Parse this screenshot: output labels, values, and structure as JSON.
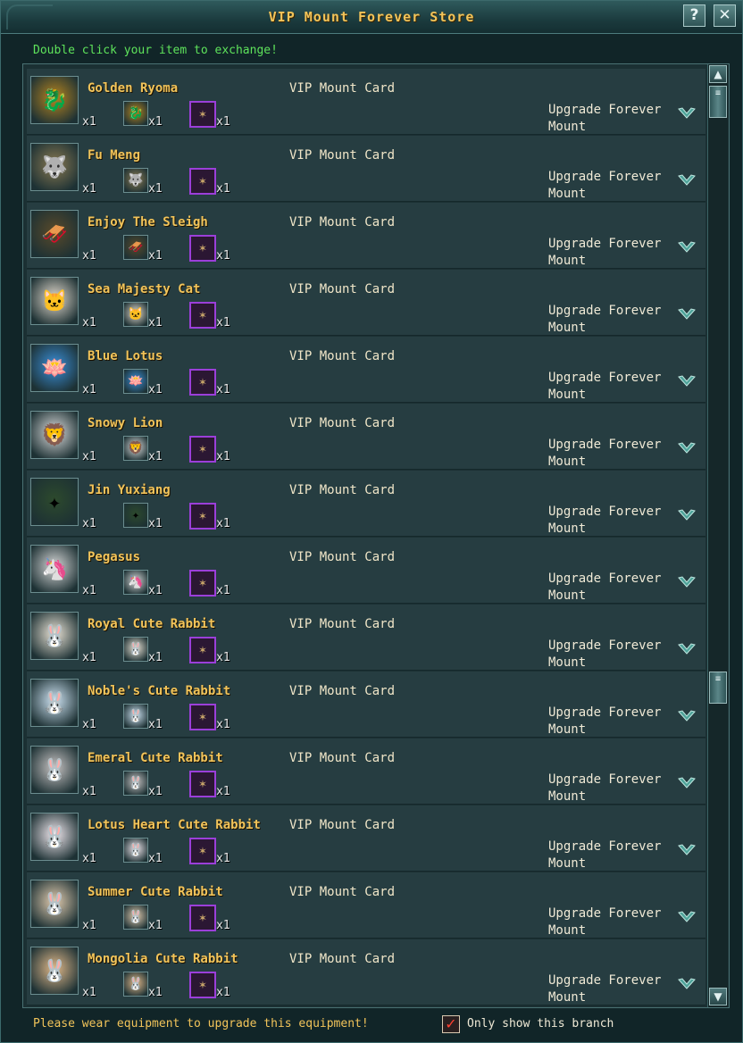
{
  "window": {
    "title": "VIP Mount Forever Store",
    "help_label": "?",
    "close_label": "✕"
  },
  "instruction": "Double click your item to exchange!",
  "qty_label": "x1",
  "cost_label": "VIP Mount Card",
  "action_line1": "Upgrade Forever",
  "action_line2": "Mount",
  "items": [
    {
      "name": "Golden Ryoma",
      "icon": "golden-dragon-icon",
      "color": "#b8861f"
    },
    {
      "name": "Fu Meng",
      "icon": "white-beast-icon",
      "color": "#8a7a52"
    },
    {
      "name": "Enjoy The Sleigh",
      "icon": "sleigh-icon",
      "color": "#5a4a2a"
    },
    {
      "name": "Sea Majesty Cat",
      "icon": "cat-icon",
      "color": "#e6dccf"
    },
    {
      "name": "Blue Lotus",
      "icon": "lotus-icon",
      "color": "#3a8fd9"
    },
    {
      "name": "Snowy Lion",
      "icon": "lion-icon",
      "color": "#dedede"
    },
    {
      "name": "Jin Yuxiang",
      "icon": "golden-staff-icon",
      "color": "#2d4a2d"
    },
    {
      "name": "Pegasus",
      "icon": "unicorn-icon",
      "color": "#d8d8d8"
    },
    {
      "name": "Royal Cute Rabbit",
      "icon": "rabbit-icon",
      "color": "#ece4d6"
    },
    {
      "name": "Noble's Cute Rabbit",
      "icon": "rabbit-icon",
      "color": "#cfe4f4"
    },
    {
      "name": "Emeral Cute Rabbit",
      "icon": "rabbit-icon",
      "color": "#c9c4c4"
    },
    {
      "name": "Lotus Heart Cute Rabbit",
      "icon": "rabbit-icon",
      "color": "#f2e8ee"
    },
    {
      "name": "Summer Cute Rabbit",
      "icon": "rabbit-icon",
      "color": "#e4cdb0"
    },
    {
      "name": "Mongolia Cute Rabbit",
      "icon": "rabbit-icon",
      "color": "#e2b98a"
    }
  ],
  "footer": {
    "hint": "Please wear equipment to upgrade this equipment!",
    "checkbox_label": "Only show this branch",
    "checkbox_checked": true
  },
  "colors": {
    "title_gold": "#f2c45a",
    "instruction_green": "#5ee35b",
    "card_border": "#9b3fd9",
    "chevron": "#4fa39a"
  }
}
